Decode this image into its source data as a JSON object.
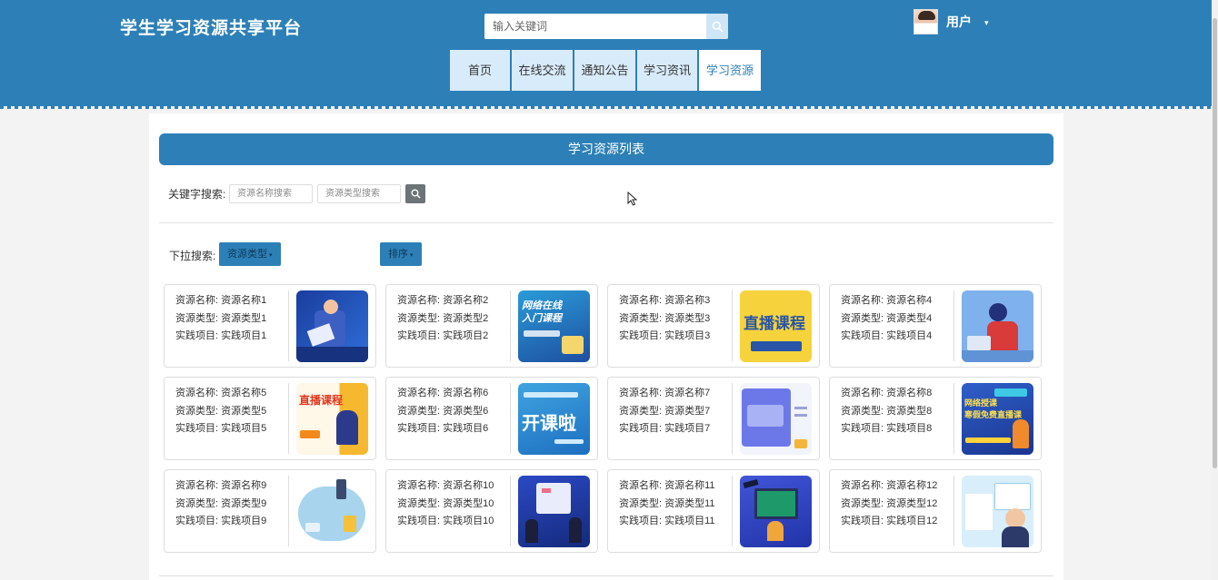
{
  "site_title": "学生学习资源共享平台",
  "search": {
    "placeholder": "输入关键词",
    "icon": "search-icon"
  },
  "user": {
    "name": "用户",
    "caret": "▾"
  },
  "nav": [
    {
      "label": "首页"
    },
    {
      "label": "在线交流"
    },
    {
      "label": "通知公告"
    },
    {
      "label": "学习资讯"
    },
    {
      "label": "学习资源",
      "active": true
    }
  ],
  "list_title": "学习资源列表",
  "filters": {
    "keyword_label": "关键字搜索:",
    "name_placeholder": "资源名称搜索",
    "type_placeholder": "资源类型搜索",
    "dropdown_label": "下拉搜索:",
    "type_button": "资源类型",
    "sort_button": "排序",
    "caret": "▾"
  },
  "cards": [
    {
      "name": "资源名称: 资源名称1",
      "type": "资源类型: 资源类型1",
      "project": "实践项目: 实践项目1",
      "thumb_text": ""
    },
    {
      "name": "资源名称: 资源名称2",
      "type": "资源类型: 资源类型2",
      "project": "实践项目: 实践项目2",
      "thumb_text": "网络在线\n入门课程"
    },
    {
      "name": "资源名称: 资源名称3",
      "type": "资源类型: 资源类型3",
      "project": "实践项目: 实践项目3",
      "thumb_text": "直播课程"
    },
    {
      "name": "资源名称: 资源名称4",
      "type": "资源类型: 资源类型4",
      "project": "实践项目: 实践项目4",
      "thumb_text": ""
    },
    {
      "name": "资源名称: 资源名称5",
      "type": "资源类型: 资源类型5",
      "project": "实践项目: 实践项目5",
      "thumb_text": "直播课程"
    },
    {
      "name": "资源名称: 资源名称6",
      "type": "资源类型: 资源类型6",
      "project": "实践项目: 实践项目6",
      "thumb_text": "开课啦"
    },
    {
      "name": "资源名称: 资源名称7",
      "type": "资源类型: 资源类型7",
      "project": "实践项目: 实践项目7",
      "thumb_text": ""
    },
    {
      "name": "资源名称: 资源名称8",
      "type": "资源类型: 资源类型8",
      "project": "实践项目: 实践项目8",
      "thumb_text": "网络授课\n寒假免费直播课"
    },
    {
      "name": "资源名称: 资源名称9",
      "type": "资源类型: 资源类型9",
      "project": "实践项目: 实践项目9",
      "thumb_text": ""
    },
    {
      "name": "资源名称: 资源名称10",
      "type": "资源类型: 资源类型10",
      "project": "实践项目: 实践项目10",
      "thumb_text": ""
    },
    {
      "name": "资源名称: 资源名称11",
      "type": "资源类型: 资源类型11",
      "project": "实践项目: 实践项目11",
      "thumb_text": ""
    },
    {
      "name": "资源名称: 资源名称12",
      "type": "资源类型: 资源类型12",
      "project": "实践项目: 实践项目12",
      "thumb_text": ""
    }
  ],
  "colors": {
    "primary": "#2d80b7",
    "nav_bg": "#d8ebfa",
    "page_bg": "#f3f3f3"
  }
}
